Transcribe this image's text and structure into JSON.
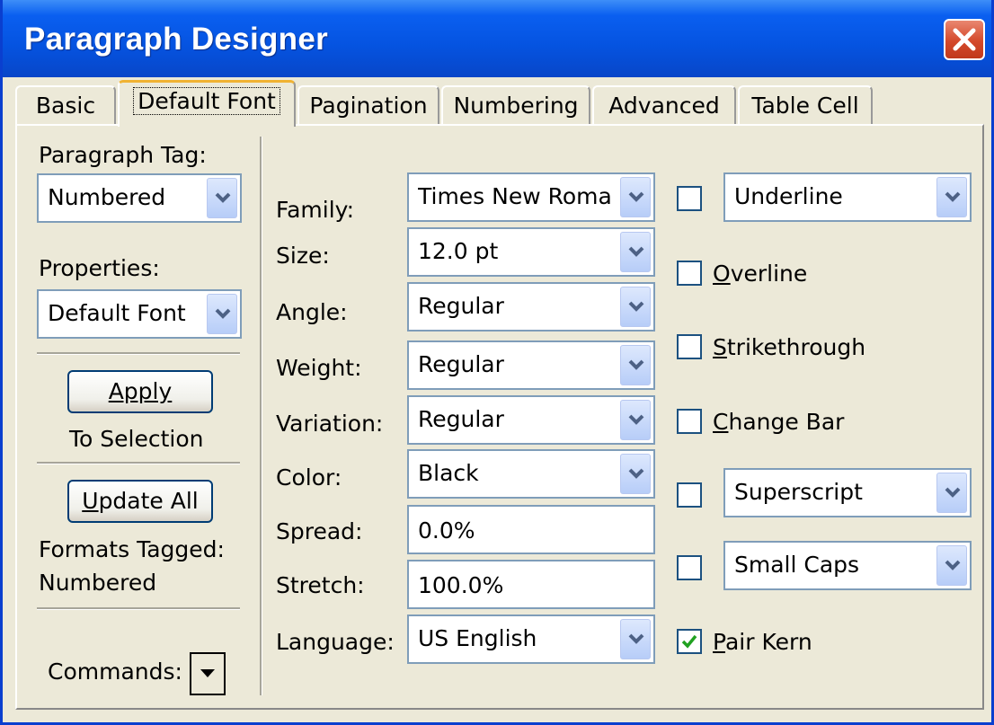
{
  "window": {
    "title": "Paragraph Designer"
  },
  "tabs": [
    "Basic",
    "Default Font",
    "Pagination",
    "Numbering",
    "Advanced",
    "Table Cell"
  ],
  "active_tab": "Default Font",
  "left": {
    "paragraph_tag_label": "Paragraph Tag:",
    "paragraph_tag_value": "Numbered",
    "properties_label": "Properties:",
    "properties_value": "Default Font",
    "apply_button": "Apply",
    "to_selection": "To Selection",
    "update_all_button": "Update All",
    "formats_tagged_label": "Formats Tagged:",
    "formats_tagged_value": "Numbered",
    "commands_label": "Commands:"
  },
  "font": {
    "family_label": "Family:",
    "family_value": "Times New Roma",
    "size_label": "Size:",
    "size_value": "12.0 pt",
    "angle_label": "Angle:",
    "angle_value": "Regular",
    "weight_label": "Weight:",
    "weight_value": "Regular",
    "variation_label": "Variation:",
    "variation_value": "Regular",
    "color_label": "Color:",
    "color_value": "Black",
    "spread_label": "Spread:",
    "spread_value": "0.0%",
    "stretch_label": "Stretch:",
    "stretch_value": "100.0%",
    "language_label": "Language:",
    "language_value": "US English"
  },
  "effects": {
    "underline_value": "Underline",
    "overline_label": "Overline",
    "strikethrough_label": "Strikethrough",
    "change_bar_label": "Change Bar",
    "superscript_value": "Superscript",
    "small_caps_value": "Small Caps",
    "pair_kern_label": "Pair Kern",
    "pair_kern_checked": true
  },
  "colors": {
    "title_bar": "#0553e0",
    "close_button": "#d4492b",
    "dialog_bg": "#ece9d8",
    "checkmark": "#21a121",
    "active_tab_accent": "#f0b232"
  }
}
